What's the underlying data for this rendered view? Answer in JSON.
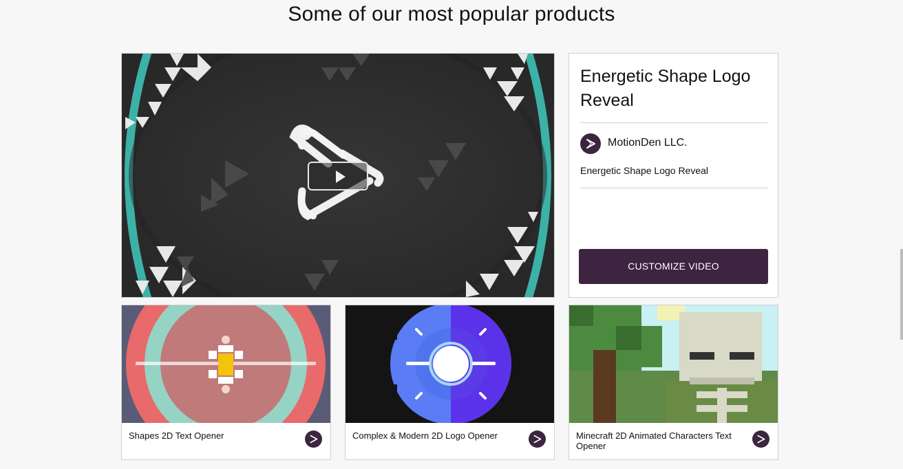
{
  "section": {
    "heading": "Some of our most popular products"
  },
  "featured": {
    "title": "Energetic Shape Logo Reveal",
    "author": "MotionDen LLC.",
    "description": "Energetic Shape Logo Reveal",
    "cta_label": "CUSTOMIZE VIDEO",
    "accent_color": "#3d2440"
  },
  "products": [
    {
      "label": "Shapes 2D Text Opener"
    },
    {
      "label": "Complex & Modern 2D Logo Opener"
    },
    {
      "label": "Minecraft 2D Animated Characters Text Opener"
    }
  ],
  "icons": {
    "play": "play-icon",
    "brand": "motionden-logo-icon"
  }
}
